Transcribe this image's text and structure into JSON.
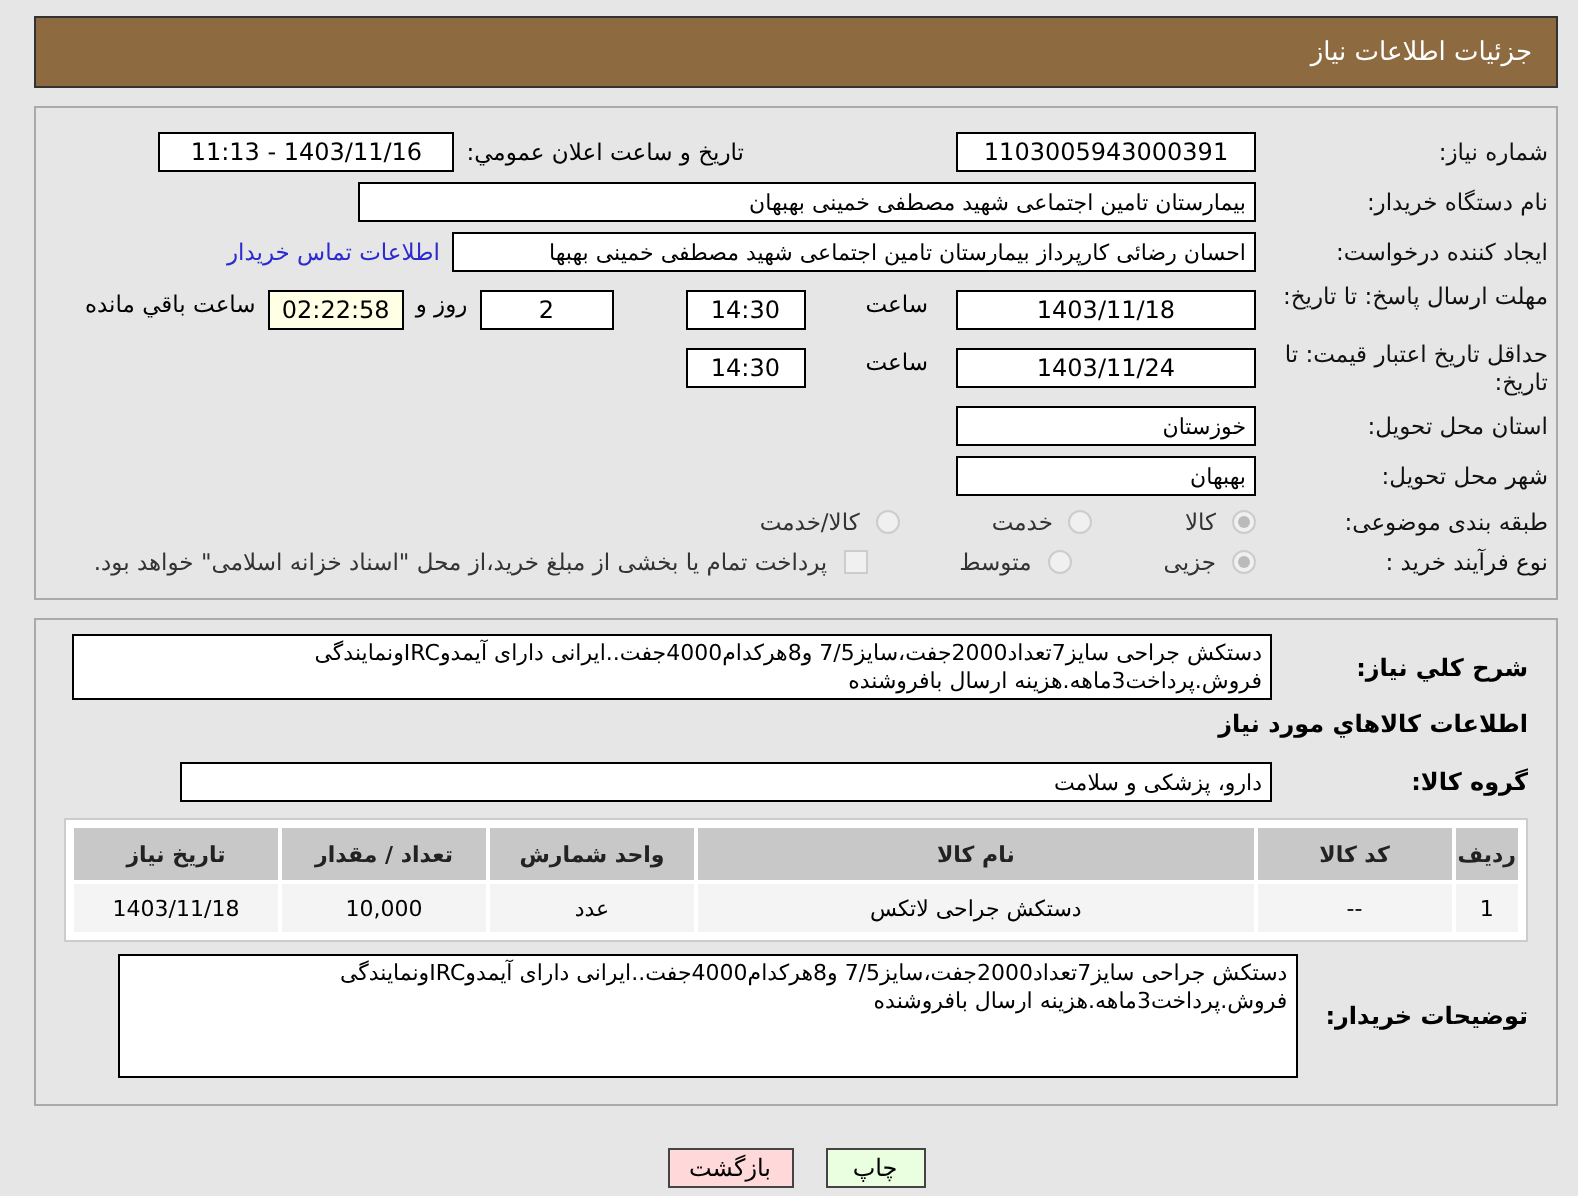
{
  "header": {
    "title": "جزئیات اطلاعات نیاز"
  },
  "need_number": {
    "label": "شماره نیاز:",
    "value": "1103005943000391"
  },
  "announce": {
    "label": "تاریخ و ساعت اعلان عمومي:",
    "value": "1403/11/16 - 11:13"
  },
  "buyer": {
    "label": "نام دستگاه خریدار:",
    "value": "بیمارستان تامین اجتماعی شهید مصطفی خمینی بهبهان"
  },
  "creator": {
    "label": "ایجاد کننده درخواست:",
    "value": "احسان رضائی کارپرداز بیمارستان تامین اجتماعی شهید مصطفی خمینی بهبها",
    "link": "اطلاعات تماس خریدار"
  },
  "deadline": {
    "label": "مهلت ارسال پاسخ: تا تاریخ:",
    "date": "1403/11/18",
    "time_label": "ساعت",
    "time": "14:30",
    "days": "2",
    "days_label": "روز و",
    "remaining": "02:22:58",
    "remaining_label": "ساعت باقي مانده"
  },
  "validity": {
    "label": "حداقل تاریخ اعتبار قیمت: تا تاریخ:",
    "date": "1403/11/24",
    "time_label": "ساعت",
    "time": "14:30"
  },
  "province": {
    "label": "استان محل تحویل:",
    "value": "خوزستان"
  },
  "city": {
    "label": "شهر محل تحویل:",
    "value": "بهبهان"
  },
  "category": {
    "label": "طبقه بندی موضوعی:",
    "options": [
      {
        "label": "کالا",
        "selected": true
      },
      {
        "label": "خدمت",
        "selected": false
      },
      {
        "label": "کالا/خدمت",
        "selected": false
      }
    ]
  },
  "purchase": {
    "label": "نوع فرآیند خرید :",
    "options": [
      {
        "label": "جزیی",
        "selected": true
      },
      {
        "label": "متوسط",
        "selected": false
      }
    ],
    "treasury": {
      "label": "پرداخت تمام یا بخشی از مبلغ خرید،از محل \"اسناد خزانه اسلامی\" خواهد بود.",
      "checked": false
    }
  },
  "summary": {
    "label": "شرح كلي نياز:",
    "value": "دستکش جراحی سایز7تعداد2000جفت،سایز7/5 و8هرکدام4000جفت..ایرانی دارای آیمدوIRCونمایندگی فروش.پرداخت3ماهه.هزینه ارسال بافروشنده"
  },
  "goods_title": "اطلاعات کالاهاي مورد نياز",
  "goods_group": {
    "label": "گروه کالا:",
    "value": "دارو، پزشکی و سلامت"
  },
  "table": {
    "columns": [
      "ردیف",
      "کد کالا",
      "نام کالا",
      "واحد شمارش",
      "تعداد / مقدار",
      "تاریخ نیاز"
    ],
    "rows": [
      [
        "1",
        "--",
        "دستکش جراحی لاتکس",
        "عدد",
        "10,000",
        "1403/11/18"
      ]
    ]
  },
  "buyer_notes": {
    "label": "توضیحات خریدار:",
    "value": "دستکش جراحی سایز7تعداد2000جفت،سایز7/5 و8هرکدام4000جفت..ایرانی دارای آیمدوIRCونمایندگی فروش.پرداخت3ماهه.هزینه ارسال بافروشنده"
  },
  "buttons": [
    {
      "kind": "print",
      "label": "چاپ"
    },
    {
      "kind": "back",
      "label": "بازگشت"
    }
  ]
}
